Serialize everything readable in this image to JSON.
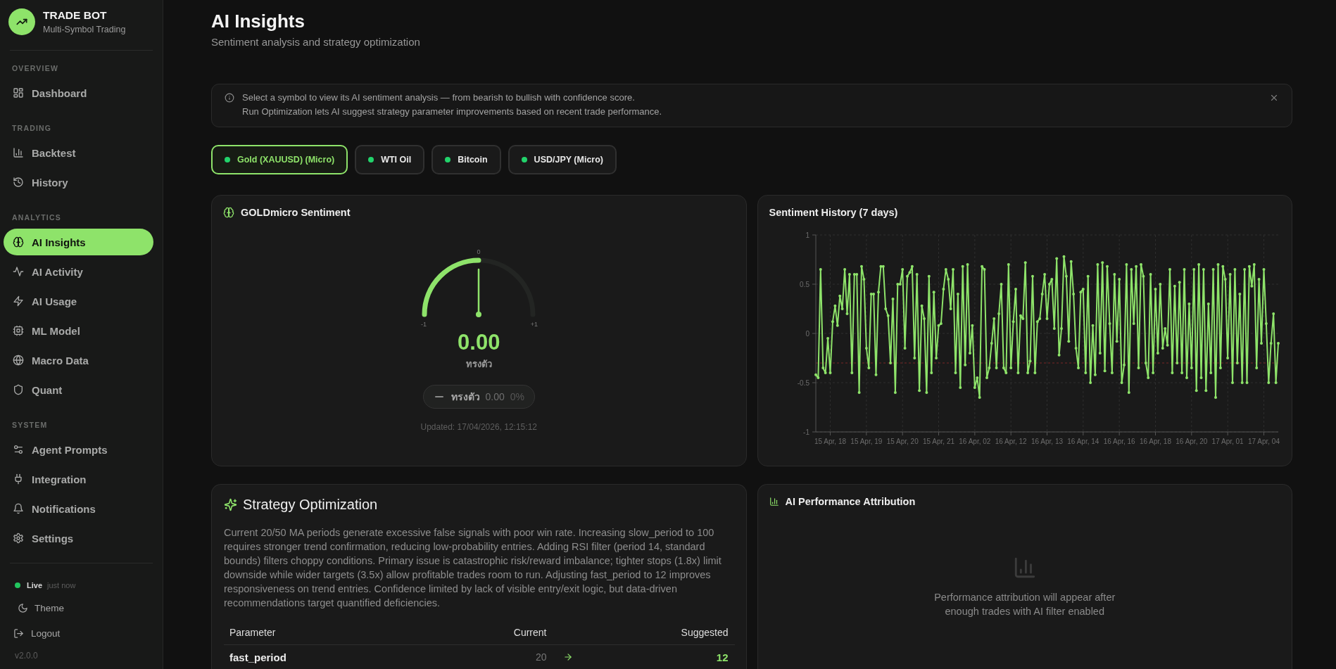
{
  "sidebar": {
    "brand": {
      "title": "TRADE BOT",
      "subtitle": "Multi-Symbol Trading"
    },
    "sections": [
      {
        "label": "OVERVIEW",
        "items": [
          {
            "label": "Dashboard",
            "selected": false
          }
        ]
      },
      {
        "label": "TRADING",
        "items": [
          {
            "label": "Backtest",
            "selected": false
          },
          {
            "label": "History",
            "selected": false
          }
        ]
      },
      {
        "label": "ANALYTICS",
        "items": [
          {
            "label": "AI Insights",
            "selected": true
          },
          {
            "label": "AI Activity",
            "selected": false
          },
          {
            "label": "AI Usage",
            "selected": false
          },
          {
            "label": "ML Model",
            "selected": false
          },
          {
            "label": "Macro Data",
            "selected": false
          },
          {
            "label": "Quant",
            "selected": false
          }
        ]
      },
      {
        "label": "SYSTEM",
        "items": [
          {
            "label": "Agent Prompts",
            "selected": false
          },
          {
            "label": "Integration",
            "selected": false
          },
          {
            "label": "Notifications",
            "selected": false
          },
          {
            "label": "Settings",
            "selected": false
          }
        ]
      }
    ],
    "footer": {
      "status": {
        "label": "Live",
        "time": "just now",
        "online": true
      },
      "theme": "Theme",
      "logout": "Logout",
      "version": "v2.0.0"
    }
  },
  "header": {
    "title": "AI Insights",
    "subtitle": "Sentiment analysis and strategy optimization"
  },
  "info_banner": {
    "lines": [
      "Select a symbol to view its AI sentiment analysis — from bearish to bullish with confidence score.",
      "Run Optimization lets AI suggest strategy parameter improvements based on recent trade performance."
    ]
  },
  "symbols": [
    {
      "label": "Gold (XAUUSD) (Micro)",
      "selected": true
    },
    {
      "label": "WTI Oil",
      "selected": false
    },
    {
      "label": "Bitcoin",
      "selected": false
    },
    {
      "label": "USD/JPY (Micro)",
      "selected": false
    }
  ],
  "sentiment": {
    "title": "GOLDmicro Sentiment",
    "gauge": {
      "level": 0.5,
      "min_label": "-1",
      "mid_label": "0",
      "max_label": "+1"
    },
    "score": "0.00",
    "label": "ทรงตัว",
    "summary": {
      "label": "ทรงตัว",
      "score": "0.00",
      "confidence": "0%"
    },
    "updated": "Updated: 17/04/2026, 12:15:12"
  },
  "sentiment_history": {
    "title": "Sentiment History (7 days)",
    "chart_data": {
      "type": "line",
      "grid": true,
      "ylim": [
        -1,
        1
      ],
      "yticks": [
        {
          "value": -1,
          "label": "-1"
        },
        {
          "value": -0.5,
          "label": "-0.5"
        },
        {
          "value": 0,
          "label": "0"
        },
        {
          "value": 0.5,
          "label": "0.5"
        },
        {
          "value": 1,
          "label": "1"
        }
      ],
      "categories": [
        null,
        null,
        null,
        null,
        null,
        null,
        "15 Apr, 18",
        null,
        null,
        null,
        null,
        null,
        null,
        null,
        null,
        null,
        null,
        null,
        null,
        null,
        null,
        "15 Apr, 19",
        null,
        null,
        null,
        null,
        null,
        null,
        null,
        null,
        null,
        null,
        null,
        null,
        null,
        null,
        "15 Apr, 20",
        null,
        null,
        null,
        null,
        null,
        null,
        null,
        null,
        null,
        null,
        null,
        null,
        null,
        null,
        "15 Apr, 21",
        null,
        null,
        null,
        null,
        null,
        null,
        null,
        null,
        null,
        null,
        null,
        null,
        null,
        null,
        "16 Apr, 02",
        null,
        null,
        null,
        null,
        null,
        null,
        null,
        null,
        null,
        null,
        null,
        null,
        null,
        null,
        "16 Apr, 12",
        null,
        null,
        null,
        null,
        null,
        null,
        null,
        null,
        null,
        null,
        null,
        null,
        null,
        null,
        "16 Apr, 13",
        null,
        null,
        null,
        null,
        null,
        null,
        null,
        null,
        null,
        null,
        null,
        null,
        null,
        null,
        "16 Apr, 14",
        null,
        null,
        null,
        null,
        null,
        null,
        null,
        null,
        null,
        null,
        null,
        null,
        null,
        null,
        "16 Apr, 16",
        null,
        null,
        null,
        null,
        null,
        null,
        null,
        null,
        null,
        null,
        null,
        null,
        null,
        null,
        "16 Apr, 18",
        null,
        null,
        null,
        null,
        null,
        null,
        null,
        null,
        null,
        null,
        null,
        null,
        null,
        null,
        "16 Apr, 20",
        null,
        null,
        null,
        null,
        null,
        null,
        null,
        null,
        null,
        null,
        null,
        null,
        null,
        null,
        "17 Apr, 01",
        null,
        null,
        null,
        null,
        null,
        null,
        null,
        null,
        null,
        null,
        null,
        null,
        null,
        null,
        "17 Apr, 04",
        null,
        null,
        null,
        null,
        null,
        null
      ],
      "values": [
        -0.42,
        -0.45,
        0.65,
        -0.35,
        -0.4,
        -0.05,
        -0.4,
        0.12,
        0.28,
        0.08,
        0.38,
        0.25,
        0.65,
        0.2,
        0.6,
        -0.4,
        0.6,
        0.6,
        -0.6,
        0.68,
        0.55,
        -0.15,
        -0.35,
        0.4,
        0.4,
        -0.42,
        0.42,
        0.68,
        0.68,
        0.25,
        0.18,
        -0.3,
        0.35,
        -0.6,
        0.5,
        0.5,
        0.65,
        -0.15,
        0.58,
        0.62,
        0.68,
        -0.25,
        0.6,
        -0.58,
        0.28,
        0.15,
        -0.6,
        0.58,
        -0.4,
        0.42,
        -0.25,
        0.08,
        0.1,
        0.45,
        0.65,
        0.55,
        0.25,
        0.65,
        -0.4,
        0.4,
        -0.55,
        0.68,
        -0.32,
        0.7,
        -0.2,
        0.08,
        -0.55,
        -0.45,
        -0.65,
        0.68,
        0.65,
        -0.45,
        -0.35,
        -0.1,
        0.15,
        -0.35,
        0.2,
        0.5,
        -0.35,
        -0.4,
        0.7,
        -0.35,
        0.12,
        0.45,
        -0.4,
        0.18,
        0.15,
        0.72,
        -0.4,
        -0.28,
        0.58,
        -0.4,
        0.12,
        0.15,
        0.4,
        0.6,
        0.15,
        0.5,
        0.55,
        0.05,
        0.76,
        -0.22,
        0.05,
        0.78,
        0.58,
        -0.08,
        0.73,
        0.4,
        -0.15,
        -0.35,
        0.42,
        0.45,
        -0.4,
        0.58,
        -0.5,
        0.08,
        -0.42,
        0.7,
        -0.2,
        0.72,
        -0.38,
        0.68,
        0.1,
        -0.4,
        0.6,
        -0.08,
        0.55,
        -0.5,
        -0.32,
        0.7,
        -0.6,
        0.65,
        0.1,
        0.68,
        -0.35,
        0.7,
        0.58,
        -0.3,
        -0.45,
        0.6,
        -0.4,
        0.45,
        -0.2,
        0.5,
        -0.15,
        0.05,
        -0.12,
        0.65,
        -0.4,
        0.48,
        -0.3,
        0.52,
        -0.4,
        0.65,
        -0.45,
        0.3,
        -0.35,
        0.65,
        -0.58,
        0.7,
        -0.45,
        0.65,
        -0.58,
        0.3,
        -0.4,
        0.65,
        -0.65,
        0.7,
        -0.35,
        0.68,
        0.55,
        -0.25,
        0.6,
        -0.5,
        0.65,
        -0.3,
        0.4,
        -0.5,
        0.65,
        -0.5,
        0.68,
        0.48,
        0.7,
        -0.35,
        0.55,
        -0.1,
        0.65,
        0.1,
        -0.5,
        -0.1,
        0.2,
        -0.5,
        -0.1
      ],
      "ref_lines": [
        {
          "axis": "y",
          "value": -0.3,
          "color": "#7a2626"
        }
      ]
    }
  },
  "optimization": {
    "title": "Strategy Optimization",
    "summary": "Current 20/50 MA periods generate excessive false signals with poor win rate. Increasing slow_period to 100 requires stronger trend confirmation, reducing low-probability entries. Adding RSI filter (period 14, standard bounds) filters choppy conditions. Primary issue is catastrophic risk/reward imbalance; tighter stops (1.8x) limit downside while wider targets (3.5x) allow profitable trades room to run. Adjusting fast_period to 12 improves responsiveness on trend entries. Confidence limited by lack of visible entry/exit logic, but data-driven recommendations target quantified deficiencies.",
    "table": {
      "columns": [
        "Parameter",
        "Current",
        "Suggested"
      ],
      "rows": [
        {
          "parameter": "fast_period",
          "current": "20",
          "suggested": "12"
        }
      ]
    }
  },
  "attribution": {
    "title": "AI Performance Attribution",
    "empty_message": "Performance attribution will appear after enough trades with AI filter enabled"
  }
}
